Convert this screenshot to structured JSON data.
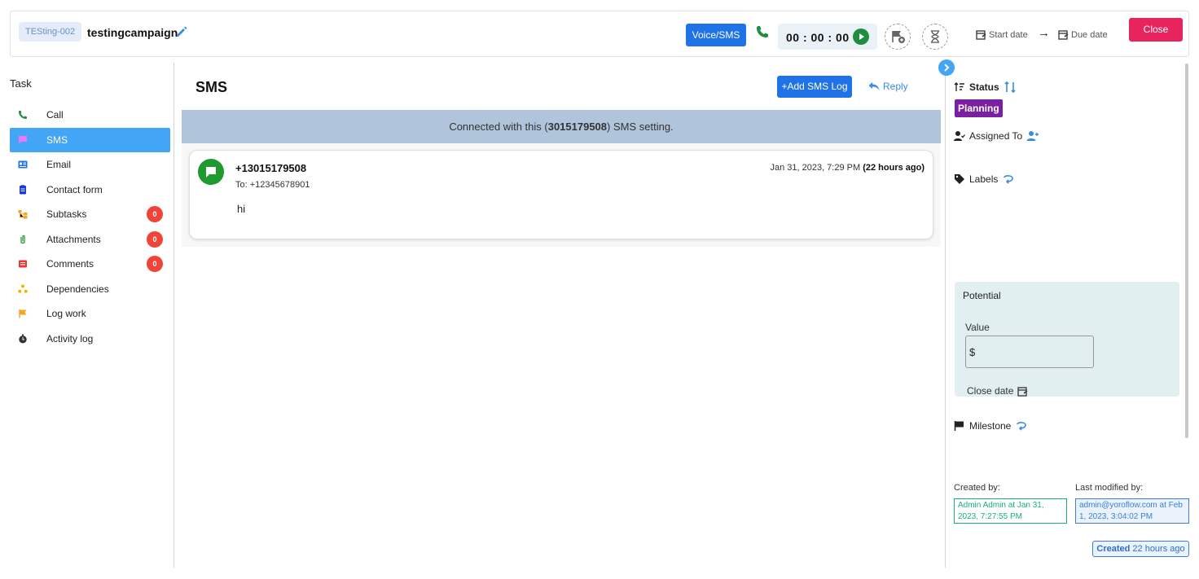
{
  "header": {
    "task_id": "TESting-002",
    "task_name": "testingcampaign",
    "voice_sms_label": "Voice/SMS",
    "timer": "00 : 00 : 00",
    "start_date": "Start date",
    "arrow": "→",
    "due_date": "Due date",
    "close_label": "Close"
  },
  "sidebar": {
    "title": "Task",
    "items": [
      {
        "label": "Call",
        "icon": "phone-icon",
        "color": "#1e8e3e"
      },
      {
        "label": "SMS",
        "icon": "chat-icon",
        "color": "#e879f9"
      },
      {
        "label": "Email",
        "icon": "email-icon",
        "color": "#1a73e8"
      },
      {
        "label": "Contact form",
        "icon": "contact-form-icon",
        "color": "#1a3ad8"
      },
      {
        "label": "Subtasks",
        "icon": "subtasks-icon",
        "color": "#f5a623",
        "badge": "0"
      },
      {
        "label": "Attachments",
        "icon": "attachment-icon",
        "color": "#2e9a3e",
        "badge": "0"
      },
      {
        "label": "Comments",
        "icon": "comments-icon",
        "color": "#e53935",
        "badge": "0"
      },
      {
        "label": "Dependencies",
        "icon": "dependencies-icon",
        "color": "#f5b400"
      },
      {
        "label": "Log work",
        "icon": "flag-icon",
        "color": "#f5a623"
      },
      {
        "label": "Activity log",
        "icon": "activity-icon",
        "color": "#333333"
      }
    ]
  },
  "main": {
    "title": "SMS",
    "add_sms_label": "+Add SMS Log",
    "reply_label": "Reply",
    "connected_prefix": "Connected with this  (",
    "connected_number": "3015179508",
    "connected_suffix": ")  SMS setting.",
    "message": {
      "from": "+13015179508",
      "to": "To: +12345678901",
      "body": "hi",
      "time": "Jan 31, 2023, 7:29 PM",
      "ago": "(22 hours ago)"
    }
  },
  "right_panel": {
    "status_label": "Status",
    "status_value": "Planning",
    "assigned_label": "Assigned To",
    "labels_label": "Labels",
    "potential": {
      "title": "Potential",
      "value_label": "Value",
      "value_input": "$",
      "close_date_label": "Close date"
    },
    "milestone_label": "Milestone",
    "created_by_label": "Created by:",
    "created_by_value": "Admin Admin at Jan 31, 2023, 7:27:55 PM",
    "modified_by_label": "Last modified by:",
    "modified_by_value": "admin@yoroflow.com at Feb 1, 2023, 3:04:02 PM",
    "created_word": "Created",
    "created_ago": "22 hours ago"
  },
  "colors": {
    "primary": "#1f73e6",
    "close": "#e8245f",
    "active": "#42a5f5",
    "status": "#7b1fa2",
    "badge": "#f04438"
  }
}
